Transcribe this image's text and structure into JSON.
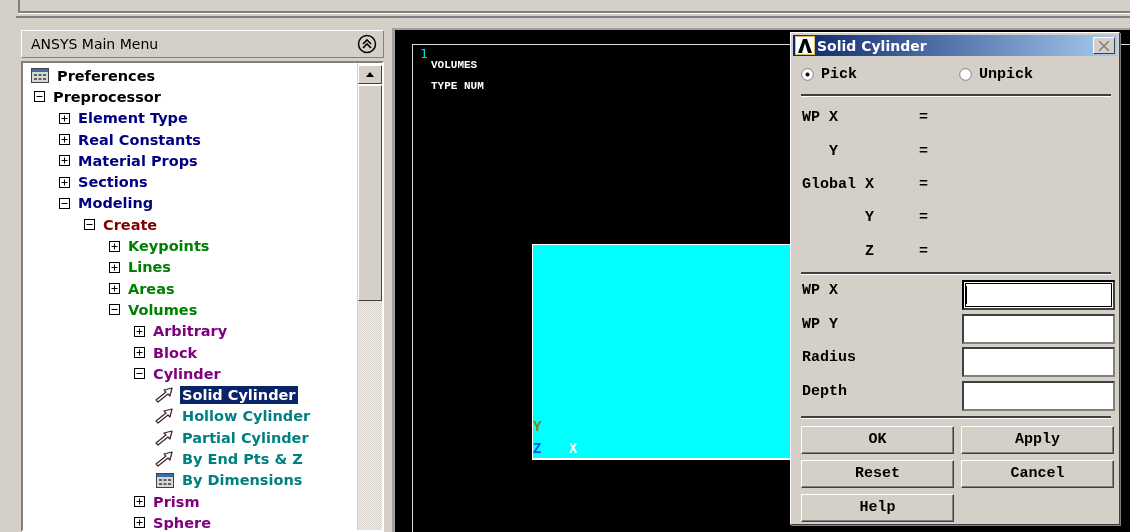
{
  "main_menu": {
    "title": "ANSYS Main Menu"
  },
  "tree": {
    "items": [
      {
        "kind": "dialog",
        "label": "Preferences",
        "selected": false
      },
      {
        "kind": "folder",
        "label": "Preprocessor",
        "expanded": true,
        "selected": false,
        "children": [
          {
            "kind": "folder",
            "label": "Element Type",
            "expanded": false,
            "selected": false
          },
          {
            "kind": "folder",
            "label": "Real Constants",
            "expanded": false,
            "selected": false
          },
          {
            "kind": "folder",
            "label": "Material Props",
            "expanded": false,
            "selected": false
          },
          {
            "kind": "folder",
            "label": "Sections",
            "expanded": false,
            "selected": false
          },
          {
            "kind": "folder",
            "label": "Modeling",
            "expanded": true,
            "selected": false,
            "children": [
              {
                "kind": "folder",
                "label": "Create",
                "expanded": true,
                "selected": false,
                "children": [
                  {
                    "kind": "folder",
                    "label": "Keypoints",
                    "expanded": false,
                    "selected": false
                  },
                  {
                    "kind": "folder",
                    "label": "Lines",
                    "expanded": false,
                    "selected": false
                  },
                  {
                    "kind": "folder",
                    "label": "Areas",
                    "expanded": false,
                    "selected": false
                  },
                  {
                    "kind": "folder",
                    "label": "Volumes",
                    "expanded": true,
                    "selected": false,
                    "children": [
                      {
                        "kind": "folder",
                        "label": "Arbitrary",
                        "expanded": false,
                        "selected": false
                      },
                      {
                        "kind": "folder",
                        "label": "Block",
                        "expanded": false,
                        "selected": false
                      },
                      {
                        "kind": "folder",
                        "label": "Cylinder",
                        "expanded": true,
                        "selected": false,
                        "children": [
                          {
                            "kind": "action",
                            "label": "Solid Cylinder",
                            "selected": true
                          },
                          {
                            "kind": "action",
                            "label": "Hollow Cylinder",
                            "selected": false
                          },
                          {
                            "kind": "action",
                            "label": "Partial Cylinder",
                            "selected": false
                          },
                          {
                            "kind": "action",
                            "label": "By End Pts & Z",
                            "selected": false
                          },
                          {
                            "kind": "dialog",
                            "label": "By Dimensions",
                            "selected": false
                          }
                        ]
                      },
                      {
                        "kind": "folder",
                        "label": "Prism",
                        "expanded": false,
                        "selected": false
                      },
                      {
                        "kind": "folder",
                        "label": "Sphere",
                        "expanded": false,
                        "selected": false
                      }
                    ]
                  }
                ]
              }
            ]
          }
        ]
      }
    ]
  },
  "graphics": {
    "window_number": "1",
    "legend": [
      "VOLUMES",
      "TYPE NUM"
    ],
    "triad": [
      {
        "axis": "Y",
        "color": "#808000"
      },
      {
        "axis": "Z",
        "color": "#0050ff"
      },
      {
        "axis": "X",
        "color": "#ffffff"
      }
    ]
  },
  "dialog": {
    "title": "Solid Cylinder",
    "modes": [
      {
        "label": "Pick",
        "selected": true
      },
      {
        "label": "Unpick",
        "selected": false
      }
    ],
    "readouts": [
      {
        "prefix": "WP",
        "rows": [
          {
            "axis": "X",
            "sign": "="
          },
          {
            "axis": "Y",
            "sign": "="
          }
        ]
      },
      {
        "prefix": "Global",
        "rows": [
          {
            "axis": "X",
            "sign": "="
          },
          {
            "axis": "Y",
            "sign": "="
          },
          {
            "axis": "Z",
            "sign": "="
          }
        ]
      }
    ],
    "fields": [
      {
        "label": "WP X",
        "focused": true
      },
      {
        "label": "WP Y",
        "focused": false
      },
      {
        "label": "Radius",
        "focused": false
      },
      {
        "label": "Depth",
        "focused": false
      }
    ],
    "buttons": [
      "OK",
      "Apply",
      "Reset",
      "Cancel",
      "Help"
    ]
  }
}
